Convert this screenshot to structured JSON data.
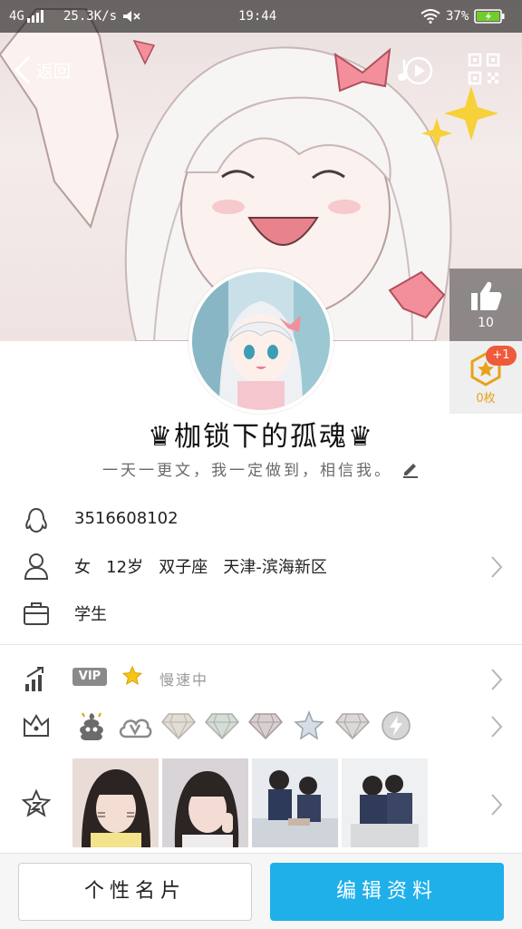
{
  "status_bar": {
    "network": "4G",
    "speed": "25.3K/s",
    "time": "19:44",
    "battery": "37%"
  },
  "nav": {
    "back_label": "返回",
    "music_icon": "music-play-icon",
    "qr_icon": "qr-code-icon"
  },
  "like": {
    "count": "10",
    "icon": "thumbs-up-icon"
  },
  "gift": {
    "badge": "+1",
    "count": "0枚",
    "icon": "star-hexagon-icon"
  },
  "profile": {
    "nickname": "♛枷锁下的孤魂♛",
    "signature": "一天一更文，我一定做到，相信我。"
  },
  "info": {
    "qq_number": "3516608102",
    "basic": "女   12岁   双子座   天津-滨海新区",
    "occupation": "学生"
  },
  "level": {
    "vip_tag": "VIP",
    "speed_text": "慢速中"
  },
  "badges": [
    "poop-badge-icon",
    "cloud-v-icon",
    "diamond-icon",
    "diamond-icon",
    "diamond-icon",
    "star-badge-icon",
    "diamond-icon",
    "lightning-icon"
  ],
  "photos": [
    "photo-1",
    "photo-2",
    "photo-3",
    "photo-4"
  ],
  "buttons": {
    "card": "个性名片",
    "edit": "编辑资料"
  },
  "colors": {
    "accent": "#1fb0ea",
    "badge_red": "#ee5a3c",
    "gold": "#e7a21a"
  }
}
